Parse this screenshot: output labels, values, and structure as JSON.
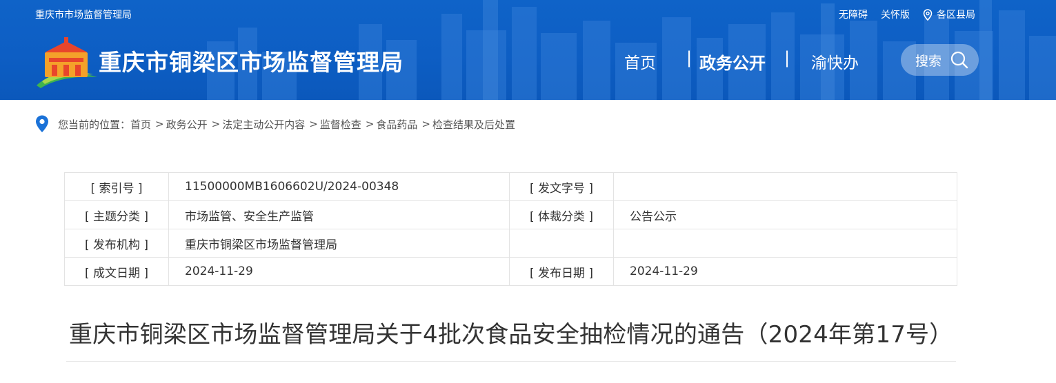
{
  "header": {
    "top_left": "重庆市市场监督管理局",
    "top_links": {
      "accessibility": "无障碍",
      "care": "关怀版",
      "districts": "各区县局"
    },
    "site_title": "重庆市铜梁区市场监督管理局",
    "nav": {
      "home": "首页",
      "separator": "|",
      "gov_affairs": "政务公开",
      "yukuaiban": "渝快办"
    },
    "search_label": "搜索",
    "colors": {
      "bg": "#0f63c8",
      "text": "#ffffff"
    }
  },
  "breadcrumb": {
    "prefix": "您当前的位置：",
    "items": [
      "首页",
      "政务公开",
      "法定主动公开内容",
      "监督检查",
      "食品药品",
      "检查结果及后处置"
    ],
    "separator": ">"
  },
  "meta_table": {
    "rows": [
      {
        "k1": "[ 索引号 ]",
        "v1": "11500000MB1606602U/2024-00348",
        "k2": "[ 发文字号 ]",
        "v2": ""
      },
      {
        "k1": "[ 主题分类 ]",
        "v1": "市场监管、安全生产监管",
        "k2": "[ 体裁分类 ]",
        "v2": "公告公示"
      },
      {
        "k1": "[ 发布机构 ]",
        "v1": "重庆市铜梁区市场监督管理局",
        "k2": "",
        "v2": ""
      },
      {
        "k1": "[ 成文日期 ]",
        "v1": "2024-11-29",
        "k2": "[ 发布日期 ]",
        "v2": "2024-11-29"
      }
    ]
  },
  "article": {
    "title": "重庆市铜梁区市场监督管理局关于4批次食品安全抽检情况的通告（2024年第17号）"
  }
}
